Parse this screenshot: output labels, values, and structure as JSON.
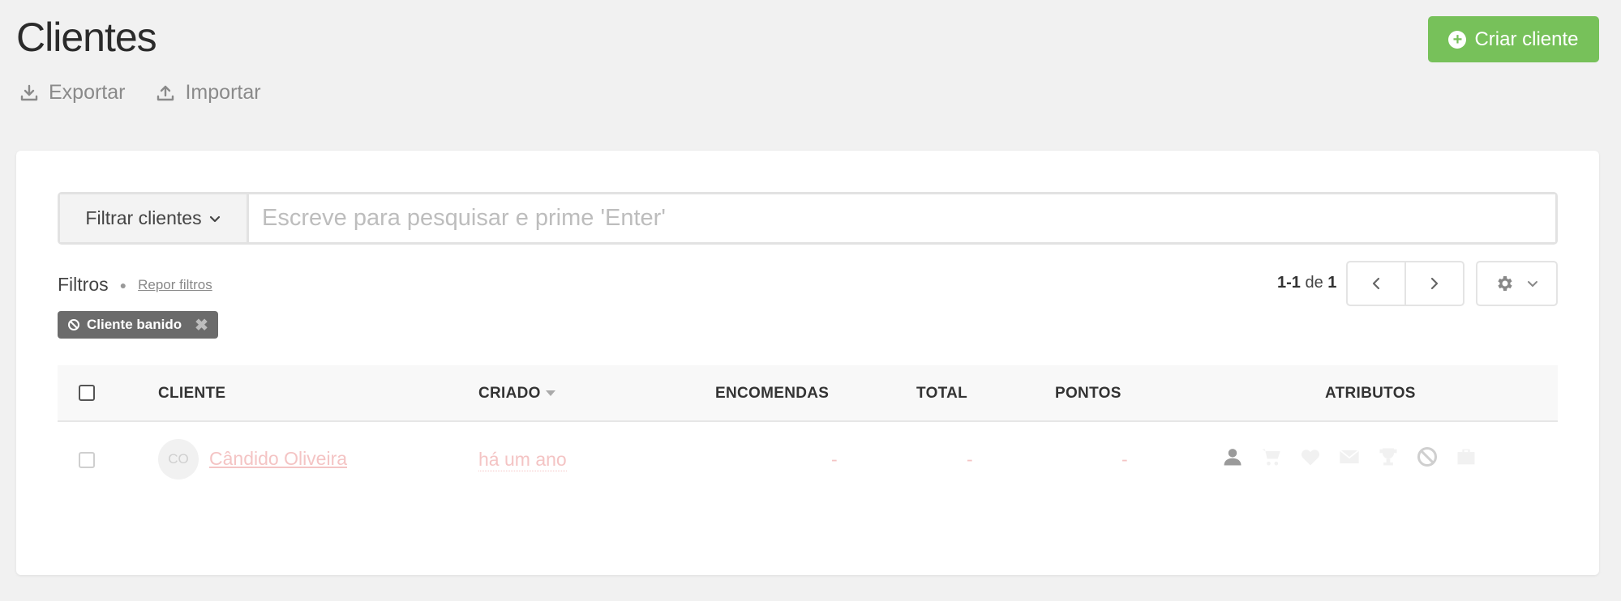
{
  "page": {
    "title": "Clientes",
    "create_button": "Criar cliente",
    "export_label": "Exportar",
    "import_label": "Importar"
  },
  "search": {
    "filter_dropdown": "Filtrar clientes",
    "placeholder": "Escreve para pesquisar e prime 'Enter'",
    "value": ""
  },
  "filters": {
    "label": "Filtros",
    "reset_label": "Repor filtros",
    "active": [
      {
        "label": "Cliente banido",
        "icon": "ban-icon"
      }
    ]
  },
  "pagination": {
    "range": "1-1",
    "of_label": "de",
    "total": "1"
  },
  "table": {
    "columns": [
      "CLIENTE",
      "CRIADO",
      "ENCOMENDAS",
      "TOTAL",
      "PONTOS",
      "ATRIBUTOS"
    ],
    "sorted_column": "CRIADO",
    "rows": [
      {
        "initials": "CO",
        "name": "Cândido Oliveira",
        "created": "há um ano",
        "orders": "-",
        "total": "-",
        "points": "-",
        "attributes": [
          "user-icon",
          "cart-icon",
          "heart-icon",
          "envelope-icon",
          "trophy-icon",
          "ban-icon",
          "briefcase-icon"
        ]
      }
    ]
  },
  "colors": {
    "accent_green": "#77c15a",
    "banned_row_text": "#f4c4c4",
    "chip_bg": "#6b6b6b"
  }
}
